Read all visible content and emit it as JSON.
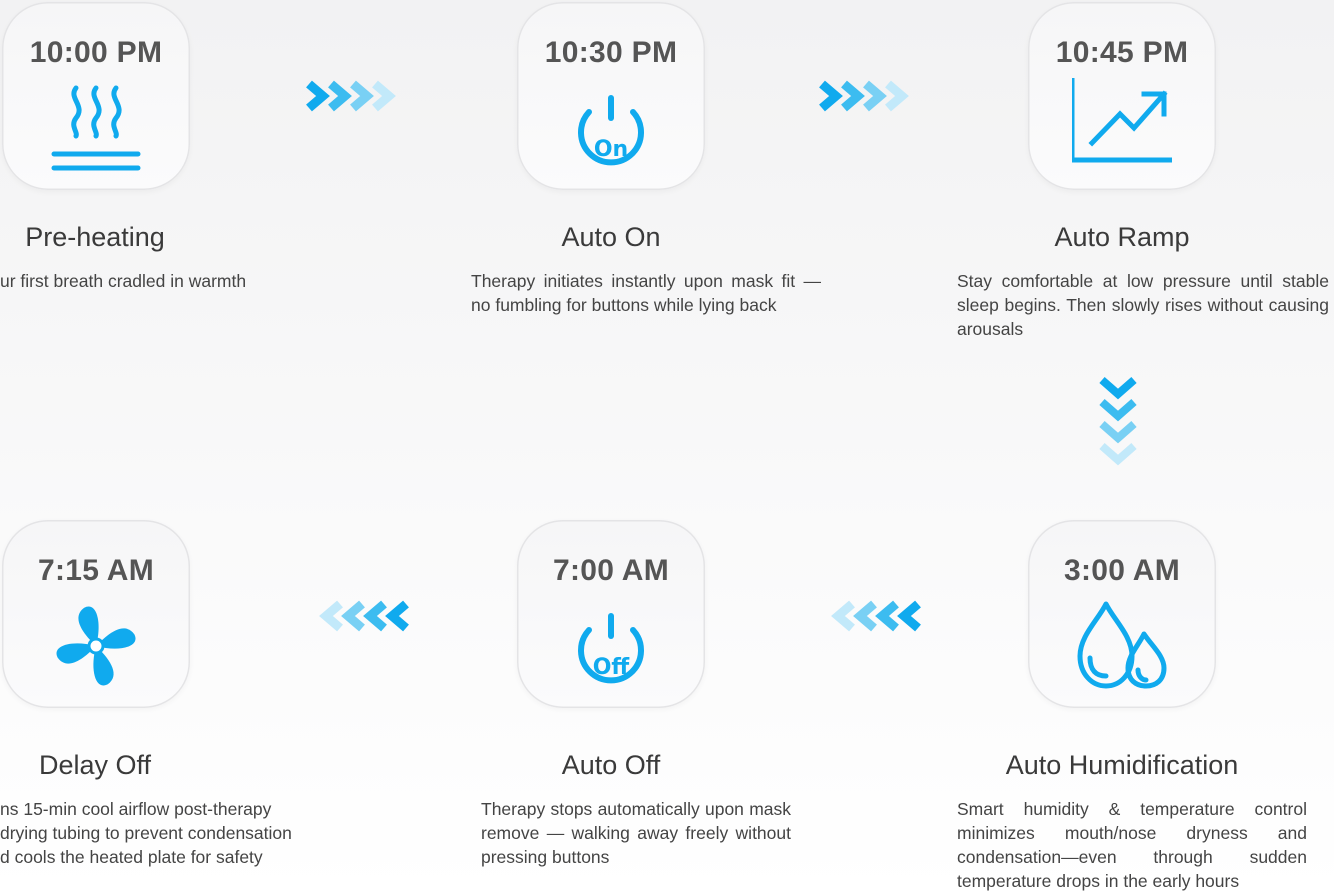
{
  "colors": {
    "accent": "#10aaee",
    "accent_light": "#9fdcf7",
    "card_border": "#e4e4e6",
    "title": "#3a3a3a",
    "time": "#555555"
  },
  "steps": [
    {
      "time": "10:00 PM",
      "icon": "heating-icon",
      "title": "Pre-heating",
      "description": "ur first breath cradled in warmth"
    },
    {
      "time": "10:30 PM",
      "icon": "power-on-icon",
      "icon_label": "On",
      "title": "Auto On",
      "description": "Therapy initiates instantly upon mask fit — no fumbling for buttons while lying back"
    },
    {
      "time": "10:45 PM",
      "icon": "ramp-chart-icon",
      "title": "Auto Ramp",
      "description": "Stay comfortable at low pressure until stable sleep begins. Then slowly rises without causing arousals"
    },
    {
      "time": "3:00 AM",
      "icon": "water-drops-icon",
      "title": "Auto Humidification",
      "description": "Smart humidity & temperature control minimizes mouth/nose dryness and condensation—even through sudden temperature drops in the early hours"
    },
    {
      "time": "7:00 AM",
      "icon": "power-off-icon",
      "icon_label": "Off",
      "title": "Auto Off",
      "description": "Therapy stops automatically upon mask remove — walking away freely without pressing buttons"
    },
    {
      "time": "7:15 AM",
      "icon": "fan-icon",
      "title": "Delay Off",
      "description_lines": [
        "ns 15-min cool airflow post-therapy",
        "drying tubing to prevent condensation",
        "d cools the heated plate for safety"
      ]
    }
  ],
  "connectors": [
    "chevrons-right",
    "chevrons-right",
    "chevrons-down",
    "chevrons-left",
    "chevrons-left"
  ]
}
